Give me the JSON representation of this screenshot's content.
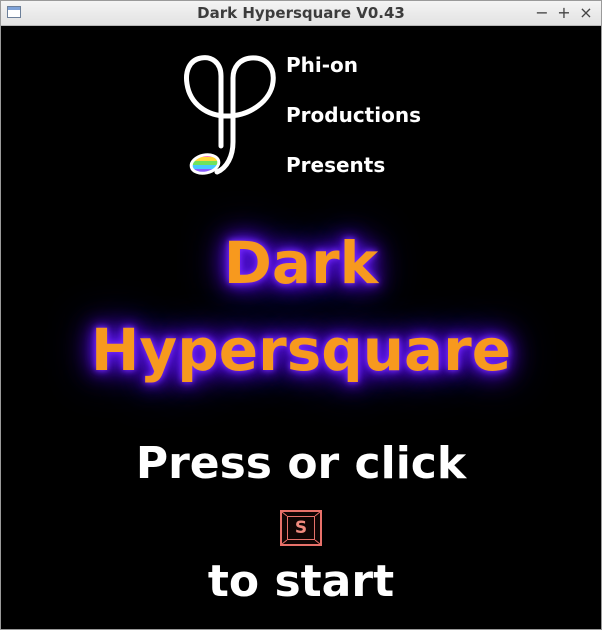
{
  "window": {
    "title": "Dark Hypersquare V0.43",
    "controls": {
      "minimize": "−",
      "maximize": "+",
      "close": "×"
    }
  },
  "studio": {
    "line1": "Phi-on",
    "line2": "Productions",
    "line3": "Presents"
  },
  "game_title": {
    "line1": "Dark",
    "line2": "Hypersquare",
    "color": "#f7991e",
    "glow_color": "#5a12f0"
  },
  "prompt": {
    "line1": "Press or click",
    "key_label": "S",
    "line2": "to start",
    "key_color": "#e8716a"
  },
  "icons": {
    "logo": "phi-on-logo-icon",
    "window": "window-icon"
  }
}
